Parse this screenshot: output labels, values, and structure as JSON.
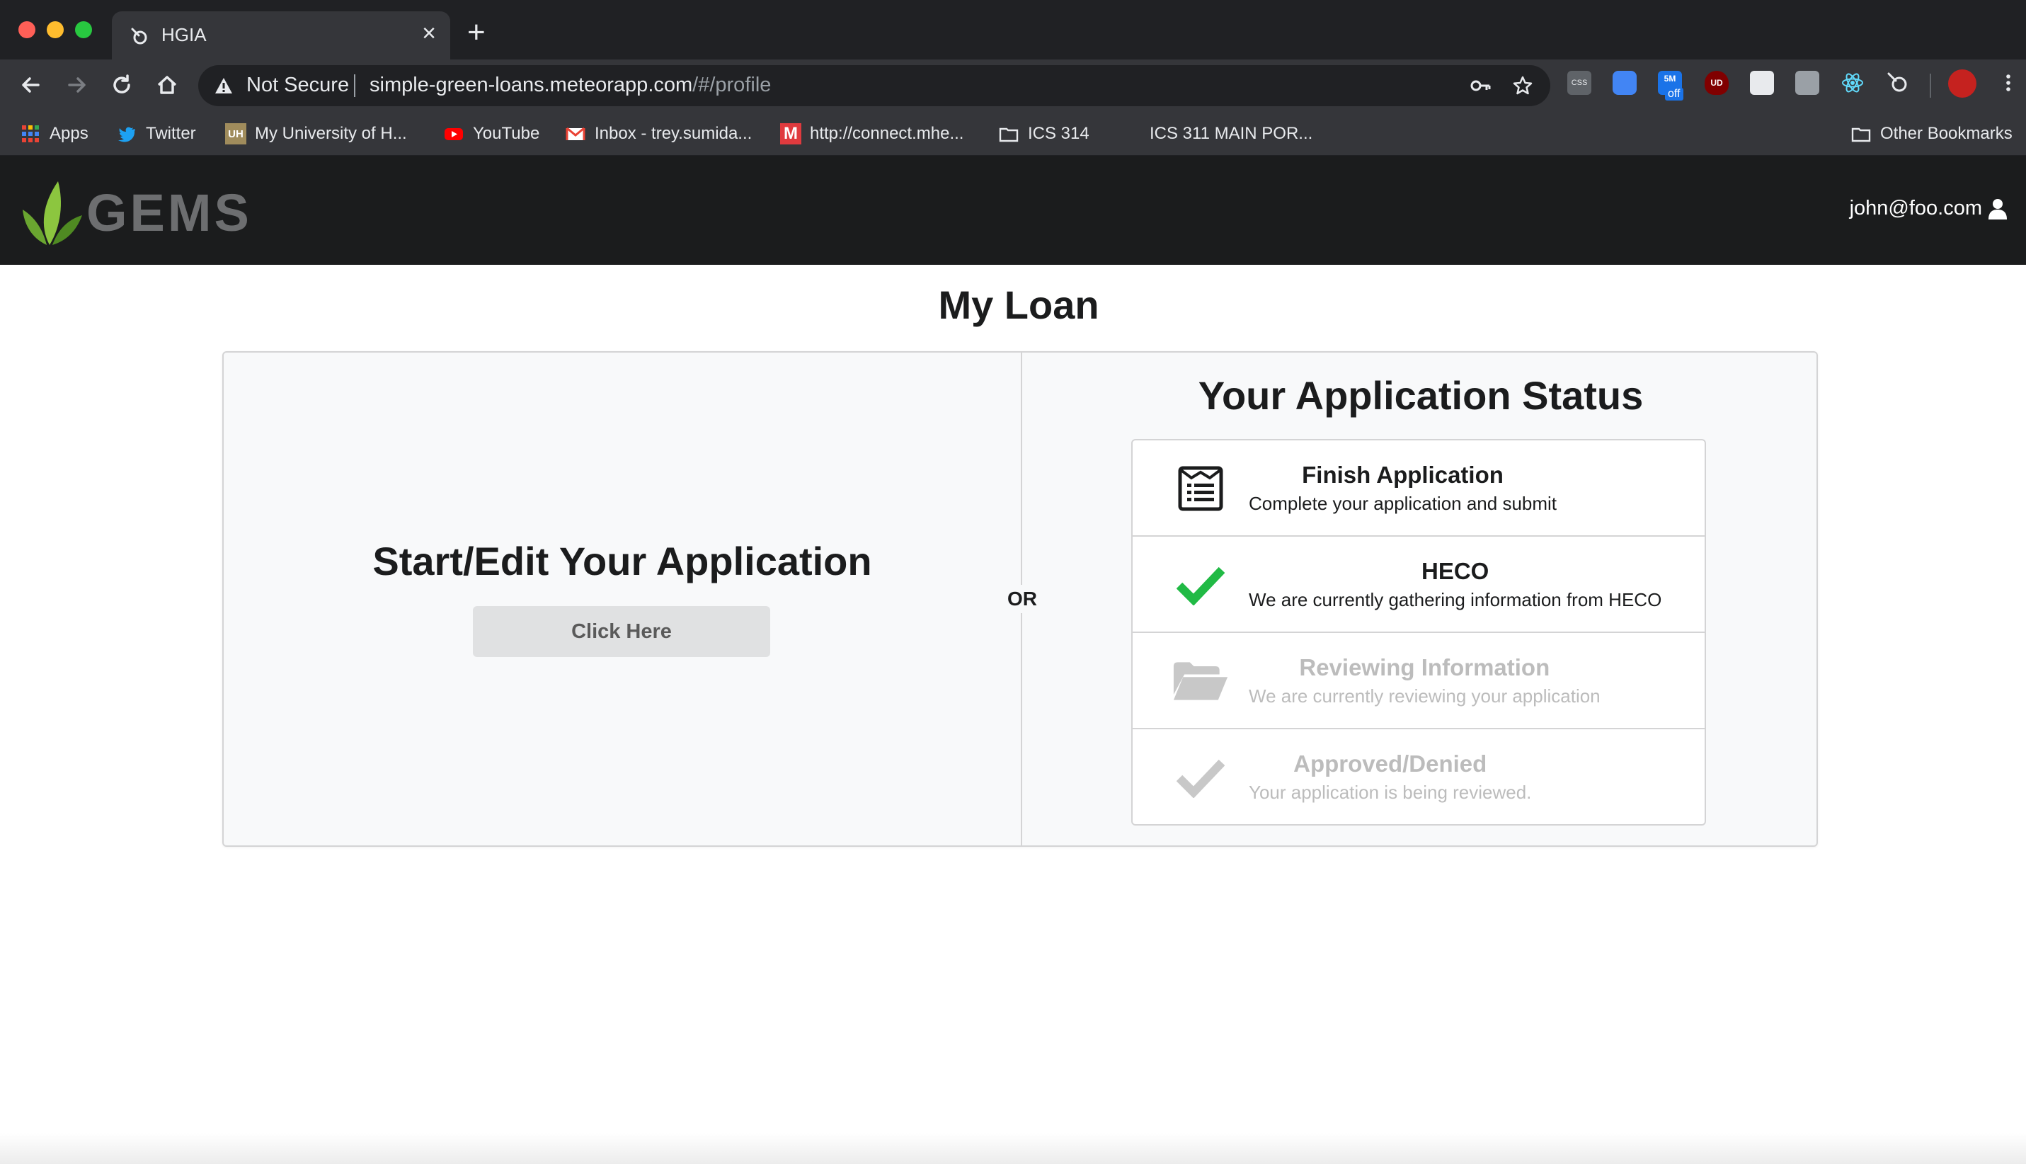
{
  "browser": {
    "tab_title": "HGIA",
    "omnibox": {
      "security_label": "Not Secure",
      "url_host": "simple-green-loans.meteorapp.com",
      "url_path": "/#/profile"
    },
    "bookmarks": [
      {
        "label": "Apps",
        "icon": "apps-grid-icon"
      },
      {
        "label": "Twitter",
        "icon": "twitter-icon"
      },
      {
        "label": "My University of H...",
        "icon": "uh-icon"
      },
      {
        "label": "YouTube",
        "icon": "youtube-icon"
      },
      {
        "label": "Inbox - trey.sumida...",
        "icon": "gmail-icon"
      },
      {
        "label": "http://connect.mhe...",
        "icon": "mcgraw-hill-icon"
      },
      {
        "label": "ICS 314",
        "icon": "folder-icon"
      },
      {
        "label": "ICS 311 MAIN POR...",
        "icon": "blank-page-icon"
      },
      {
        "label": "Other Bookmarks",
        "icon": "folder-icon"
      }
    ],
    "extension_badge": "off",
    "extension_label_css": "CSS",
    "extension_label_5m": "5M",
    "extension_label_ud": "UD"
  },
  "app": {
    "logo_text": "GEMS",
    "user_email": "john@foo.com",
    "page_title": "My Loan",
    "start_section": {
      "title": "Start/Edit Your Application",
      "button_label": "Click Here"
    },
    "or_label": "OR",
    "status_section": {
      "title": "Your Application Status",
      "steps": [
        {
          "title": "Finish Application",
          "description": "Complete your application and submit",
          "icon": "newspaper-icon",
          "state": "active"
        },
        {
          "title": "HECO",
          "description": "We are currently gathering information from HECO",
          "icon": "check-icon",
          "state": "completed"
        },
        {
          "title": "Reviewing Information",
          "description": "We are currently reviewing your application",
          "icon": "folder-open-icon",
          "state": "disabled"
        },
        {
          "title": "Approved/Denied",
          "description": "Your application is being reviewed.",
          "icon": "check-icon",
          "state": "disabled"
        }
      ]
    }
  },
  "colors": {
    "navbar_bg": "#1b1c1d",
    "logo_green": "#8cc63f",
    "logo_gray": "#6d6e70",
    "check_green": "#21ba45",
    "disabled_text": "#bcbcbc",
    "button_bg": "#e0e1e2"
  }
}
